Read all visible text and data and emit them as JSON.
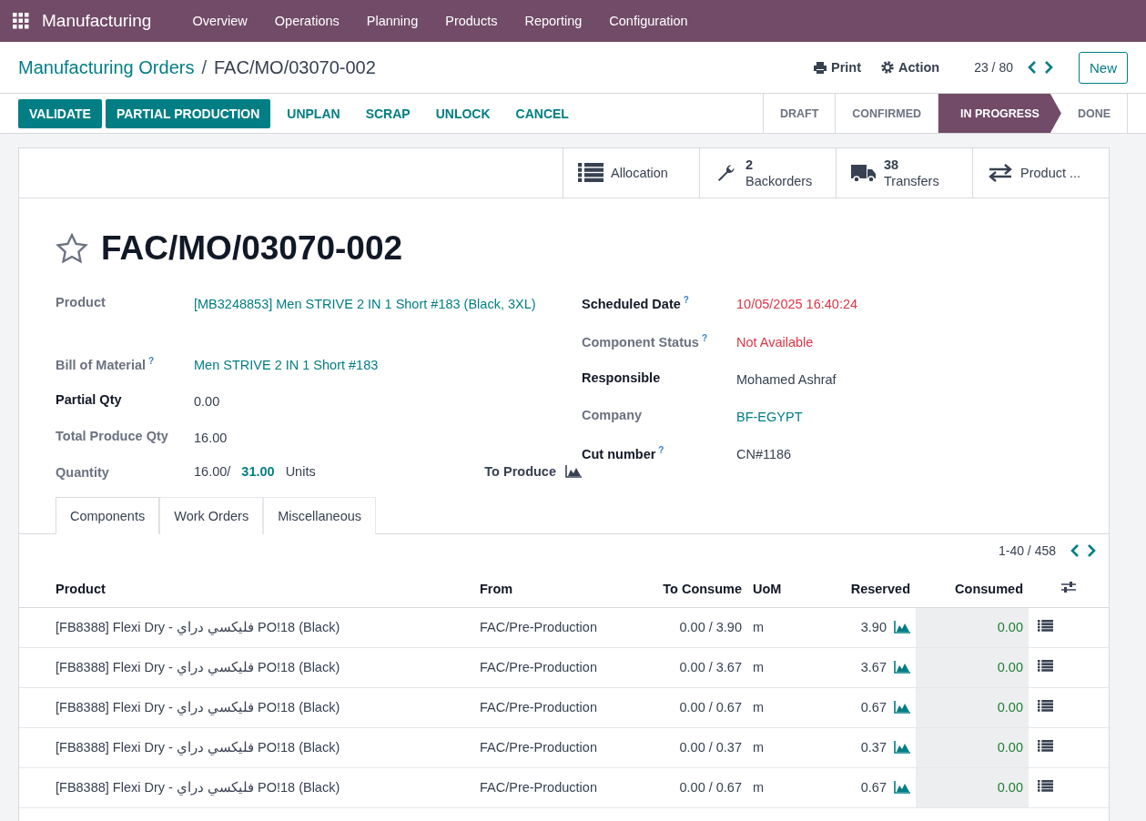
{
  "navbar": {
    "app": "Manufacturing",
    "menu": [
      "Overview",
      "Operations",
      "Planning",
      "Products",
      "Reporting",
      "Configuration"
    ]
  },
  "control_panel": {
    "breadcrumb": [
      {
        "label": "Manufacturing Orders"
      },
      {
        "label": "FAC/MO/03070-002"
      }
    ],
    "separator": "/",
    "print": "Print",
    "action": "Action",
    "pager": "23 / 80",
    "new": "New"
  },
  "actions": [
    {
      "label": "VALIDATE",
      "primary": true
    },
    {
      "label": "PARTIAL PRODUCTION",
      "primary": true
    },
    {
      "label": "UNPLAN",
      "primary": false
    },
    {
      "label": "SCRAP",
      "primary": false
    },
    {
      "label": "UNLOCK",
      "primary": false
    },
    {
      "label": "CANCEL",
      "primary": false
    }
  ],
  "stages": [
    {
      "label": "DRAFT",
      "selected": false
    },
    {
      "label": "CONFIRMED",
      "selected": false
    },
    {
      "label": "IN PROGRESS",
      "selected": true
    },
    {
      "label": "DONE",
      "selected": false
    }
  ],
  "smart_buttons": [
    {
      "kind": "list",
      "label": "Allocation"
    },
    {
      "kind": "wrench",
      "count": "2",
      "label": "Backorders"
    },
    {
      "kind": "truck",
      "count": "38",
      "label": "Transfers"
    },
    {
      "kind": "arrows",
      "label": "Product ..."
    }
  ],
  "record": {
    "title": "FAC/MO/03070-002",
    "starred": false
  },
  "left_fields": [
    {
      "label": "Product",
      "required": false,
      "value": "[MB3248853] Men STRIVE 2 IN 1 Short #183 (Black, 3XL)",
      "kind": "link"
    },
    {
      "label": "Bill of Material",
      "help": "?",
      "required": false,
      "value": "Men STRIVE 2 IN 1 Short #183",
      "kind": "link"
    },
    {
      "label": "Partial Qty",
      "required": true,
      "value": "0.00",
      "kind": "plain"
    },
    {
      "label": "Total Produce Qty",
      "required": false,
      "value": "16.00",
      "kind": "plain"
    }
  ],
  "quantity": {
    "label": "Quantity",
    "produced": "16.00/",
    "target": "31.00",
    "unit": "Units",
    "to_produce": "To Produce"
  },
  "right_fields": [
    {
      "label": "Scheduled Date",
      "help": "?",
      "required": true,
      "value": "10/05/2025 16:40:24",
      "kind": "danger"
    },
    {
      "label": "Component Status",
      "help": "?",
      "required": false,
      "value": "Not Available",
      "kind": "danger"
    },
    {
      "label": "Responsible",
      "required": true,
      "value": "Mohamed Ashraf",
      "kind": "plain"
    },
    {
      "label": "Company",
      "required": false,
      "value": "BF-EGYPT",
      "kind": "link"
    },
    {
      "label": "Cut number",
      "help": "?",
      "required": true,
      "value": "CN#1186",
      "kind": "plain"
    }
  ],
  "tabs": [
    {
      "label": "Components",
      "selected": true
    },
    {
      "label": "Work Orders",
      "selected": false
    },
    {
      "label": "Miscellaneous",
      "selected": false
    }
  ],
  "table": {
    "pager": "1-40 / 458",
    "columns": [
      "Product",
      "From",
      "To Consume",
      "UoM",
      "Reserved",
      "Consumed"
    ],
    "rows": [
      {
        "product": "[FB8388] Flexi Dry - فليكسي دراي PO!18 (Black)",
        "from": "FAC/Pre-Production",
        "to_consume": "0.00 / 3.90",
        "uom": "m",
        "reserved": "3.90",
        "consumed": "0.00"
      },
      {
        "product": "[FB8388] Flexi Dry - فليكسي دراي PO!18 (Black)",
        "from": "FAC/Pre-Production",
        "to_consume": "0.00 / 3.67",
        "uom": "m",
        "reserved": "3.67",
        "consumed": "0.00"
      },
      {
        "product": "[FB8388] Flexi Dry - فليكسي دراي PO!18 (Black)",
        "from": "FAC/Pre-Production",
        "to_consume": "0.00 / 0.67",
        "uom": "m",
        "reserved": "0.67",
        "consumed": "0.00"
      },
      {
        "product": "[FB8388] Flexi Dry - فليكسي دراي PO!18 (Black)",
        "from": "FAC/Pre-Production",
        "to_consume": "0.00 / 0.37",
        "uom": "m",
        "reserved": "0.37",
        "consumed": "0.00"
      },
      {
        "product": "[FB8388] Flexi Dry - فليكسي دراي PO!18 (Black)",
        "from": "FAC/Pre-Production",
        "to_consume": "0.00 / 0.67",
        "uom": "m",
        "reserved": "0.67",
        "consumed": "0.00"
      }
    ]
  }
}
